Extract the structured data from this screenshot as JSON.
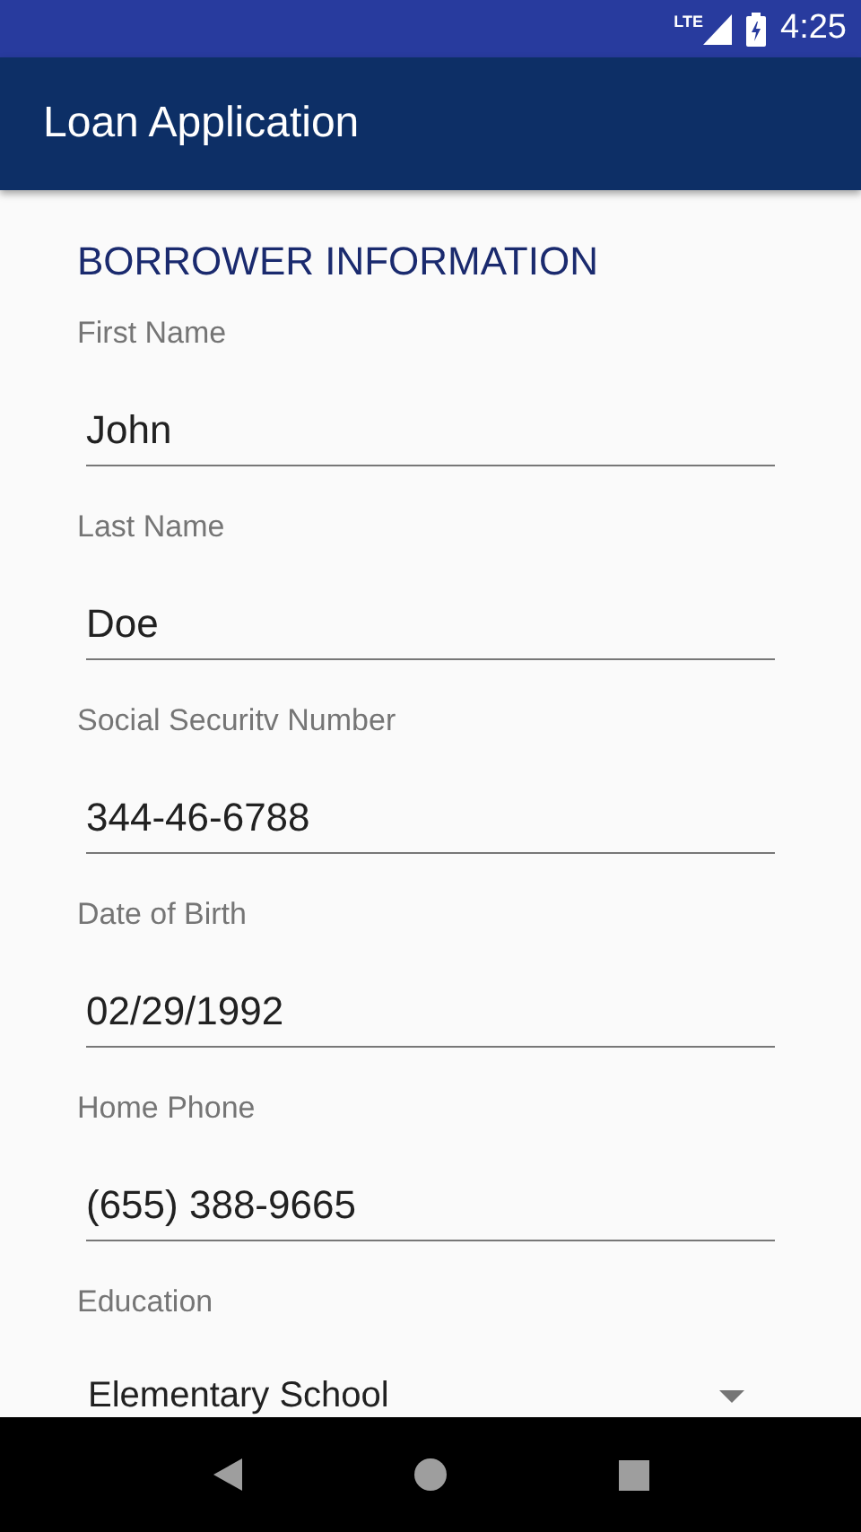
{
  "status_bar": {
    "network": "LTE",
    "time": "4:25"
  },
  "app_bar": {
    "title": "Loan Application"
  },
  "section": {
    "title": "BORROWER INFORMATION"
  },
  "fields": [
    {
      "kind": "text",
      "label": "First Name",
      "value": "John"
    },
    {
      "kind": "text",
      "label": "Last Name",
      "value": "Doe"
    },
    {
      "kind": "text",
      "label": "Social Securitv Number",
      "value": "344-46-6788"
    },
    {
      "kind": "text",
      "label": "Date of Birth",
      "value": "02/29/1992"
    },
    {
      "kind": "text",
      "label": "Home Phone",
      "value": "(655) 388-9665"
    },
    {
      "kind": "spinner",
      "label": "Education",
      "value": "Elementary School"
    }
  ]
}
